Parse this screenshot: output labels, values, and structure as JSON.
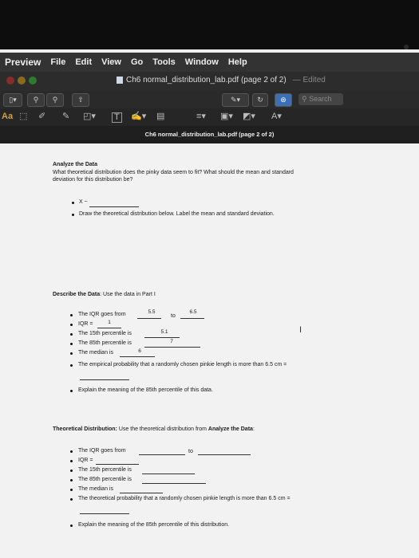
{
  "menubar": {
    "app": "Preview",
    "items": [
      "File",
      "Edit",
      "View",
      "Go",
      "Tools",
      "Window",
      "Help"
    ]
  },
  "window": {
    "title": "Ch6 normal_distribution_lab.pdf (page 2 of 2)",
    "edited": "— Edited"
  },
  "toolbar": {
    "search_placeholder": "Search",
    "aa_label": "Aa",
    "text_label": "T",
    "font_label": "A"
  },
  "docbar": {
    "title": "Ch6 normal_distribution_lab.pdf (page 2 of 2)"
  },
  "doc": {
    "analyze": {
      "heading": "Analyze the Data",
      "question_line1": "What theoretical distribution does the pinky data seem to fit? What should the mean and standard",
      "question_line2": "deviation for this distribution be?",
      "bullet1": "X ~",
      "bullet2": "Draw the theoretical distribution below. Label the mean and standard deviation."
    },
    "describe": {
      "heading_bold": "Describe the Data",
      "heading_rest": ": Use the data in Part I",
      "iqr_from_label": "The IQR goes from",
      "iqr_from_value": "5.5",
      "to_label": "to",
      "iqr_to_value": "6.5",
      "iqr_label": "IQR =",
      "iqr_value": "1",
      "p15_label": "The 15th percentile is",
      "p15_value": "5.1",
      "p85_label": "The 85th percentile is",
      "p85_value": "7",
      "median_label": "The median is",
      "median_value": "6",
      "empirical_prob": "The empirical probability that a randomly chosen pinkie length is more than 6.5 cm =",
      "explain": "Explain the meaning of the 85th percentile of this data."
    },
    "theoretical": {
      "heading_bold": "Theoretical Distribution:",
      "heading_rest": " Use the theoretical distribution from ",
      "heading_bold2": "Analyze the Data",
      "heading_end": ":",
      "iqr_from_label": "The IQR goes from",
      "to_label": "to",
      "iqr_label": "IQR =",
      "p15_label": "The 15th percentile is",
      "p85_label": "The 85th percentile is",
      "median_label": "The median is",
      "theoretical_prob": "The theoretical probability that a randomly chosen pinkie length is more than 6.5 cm =",
      "explain": "Explain the meaning of the 85th percentile of this distribution."
    }
  }
}
